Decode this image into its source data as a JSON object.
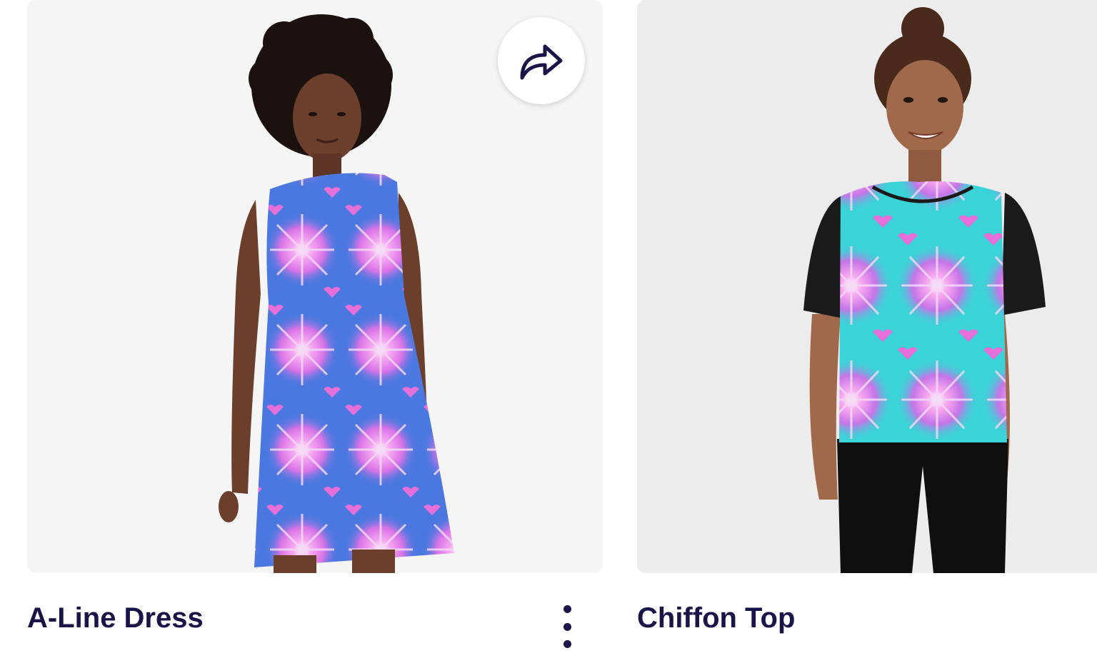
{
  "products": [
    {
      "title": "A-Line Dress",
      "image_alt": "A-Line Dress"
    },
    {
      "title": "Chiffon Top",
      "image_alt": "Chiffon Top"
    }
  ],
  "icons": {
    "share": "share-arrow-icon",
    "more": "more-vertical-icon"
  },
  "colors": {
    "title_text": "#191548",
    "dress_base": "#4a78e0",
    "top_base": "#3ad4d8",
    "pattern_pink": "#e070e8",
    "sleeve_black": "#1a1a1a"
  }
}
